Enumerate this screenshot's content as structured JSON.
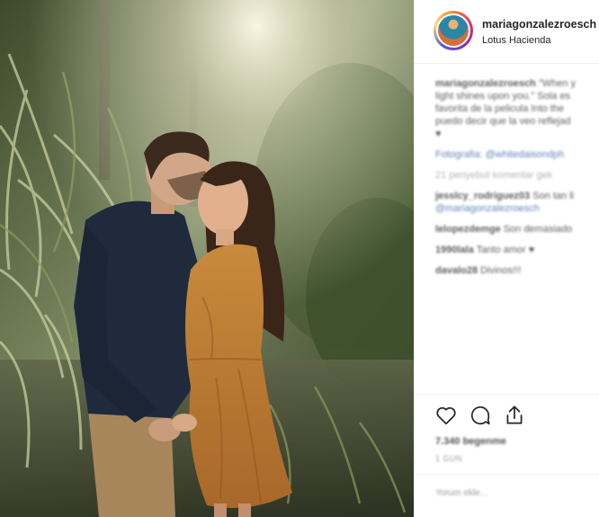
{
  "post": {
    "username": "mariagonzalezroesch",
    "location": "Lotus Hacienda"
  },
  "comments": [
    {
      "user": "mariagonzalezroesch",
      "text": "\"When y"
    },
    {
      "user": "",
      "text": "light shines upon you.\" Sola es"
    },
    {
      "user": "",
      "text": "favorita de la pelicula Into the"
    },
    {
      "user": "",
      "text": "puedo decir que la veo reflejad"
    },
    {
      "user": "",
      "text": "♥"
    },
    {
      "user": "",
      "text": "Fotografia: @whitedaisondph"
    },
    {
      "user": "",
      "text": "21 penyebut komentar gek"
    },
    {
      "user": "jesslcy_rodriguez03",
      "text": "Son tan li"
    },
    {
      "user": "",
      "text": "@mariagonzalezroesch"
    },
    {
      "user": "lelopezdemge",
      "text": "Son demasiado"
    },
    {
      "user": "1990lala",
      "text": "Tanto amor ♥"
    },
    {
      "user": "davalo28",
      "text": "Divinos!!!"
    }
  ],
  "actions": {
    "like_icon": "heart-icon",
    "comment_icon": "comment-icon",
    "share_icon": "share-icon"
  },
  "likes_text": "7.340 begenme",
  "time_text": "1 GUN",
  "add_comment_text": "Yorum ekle..."
}
